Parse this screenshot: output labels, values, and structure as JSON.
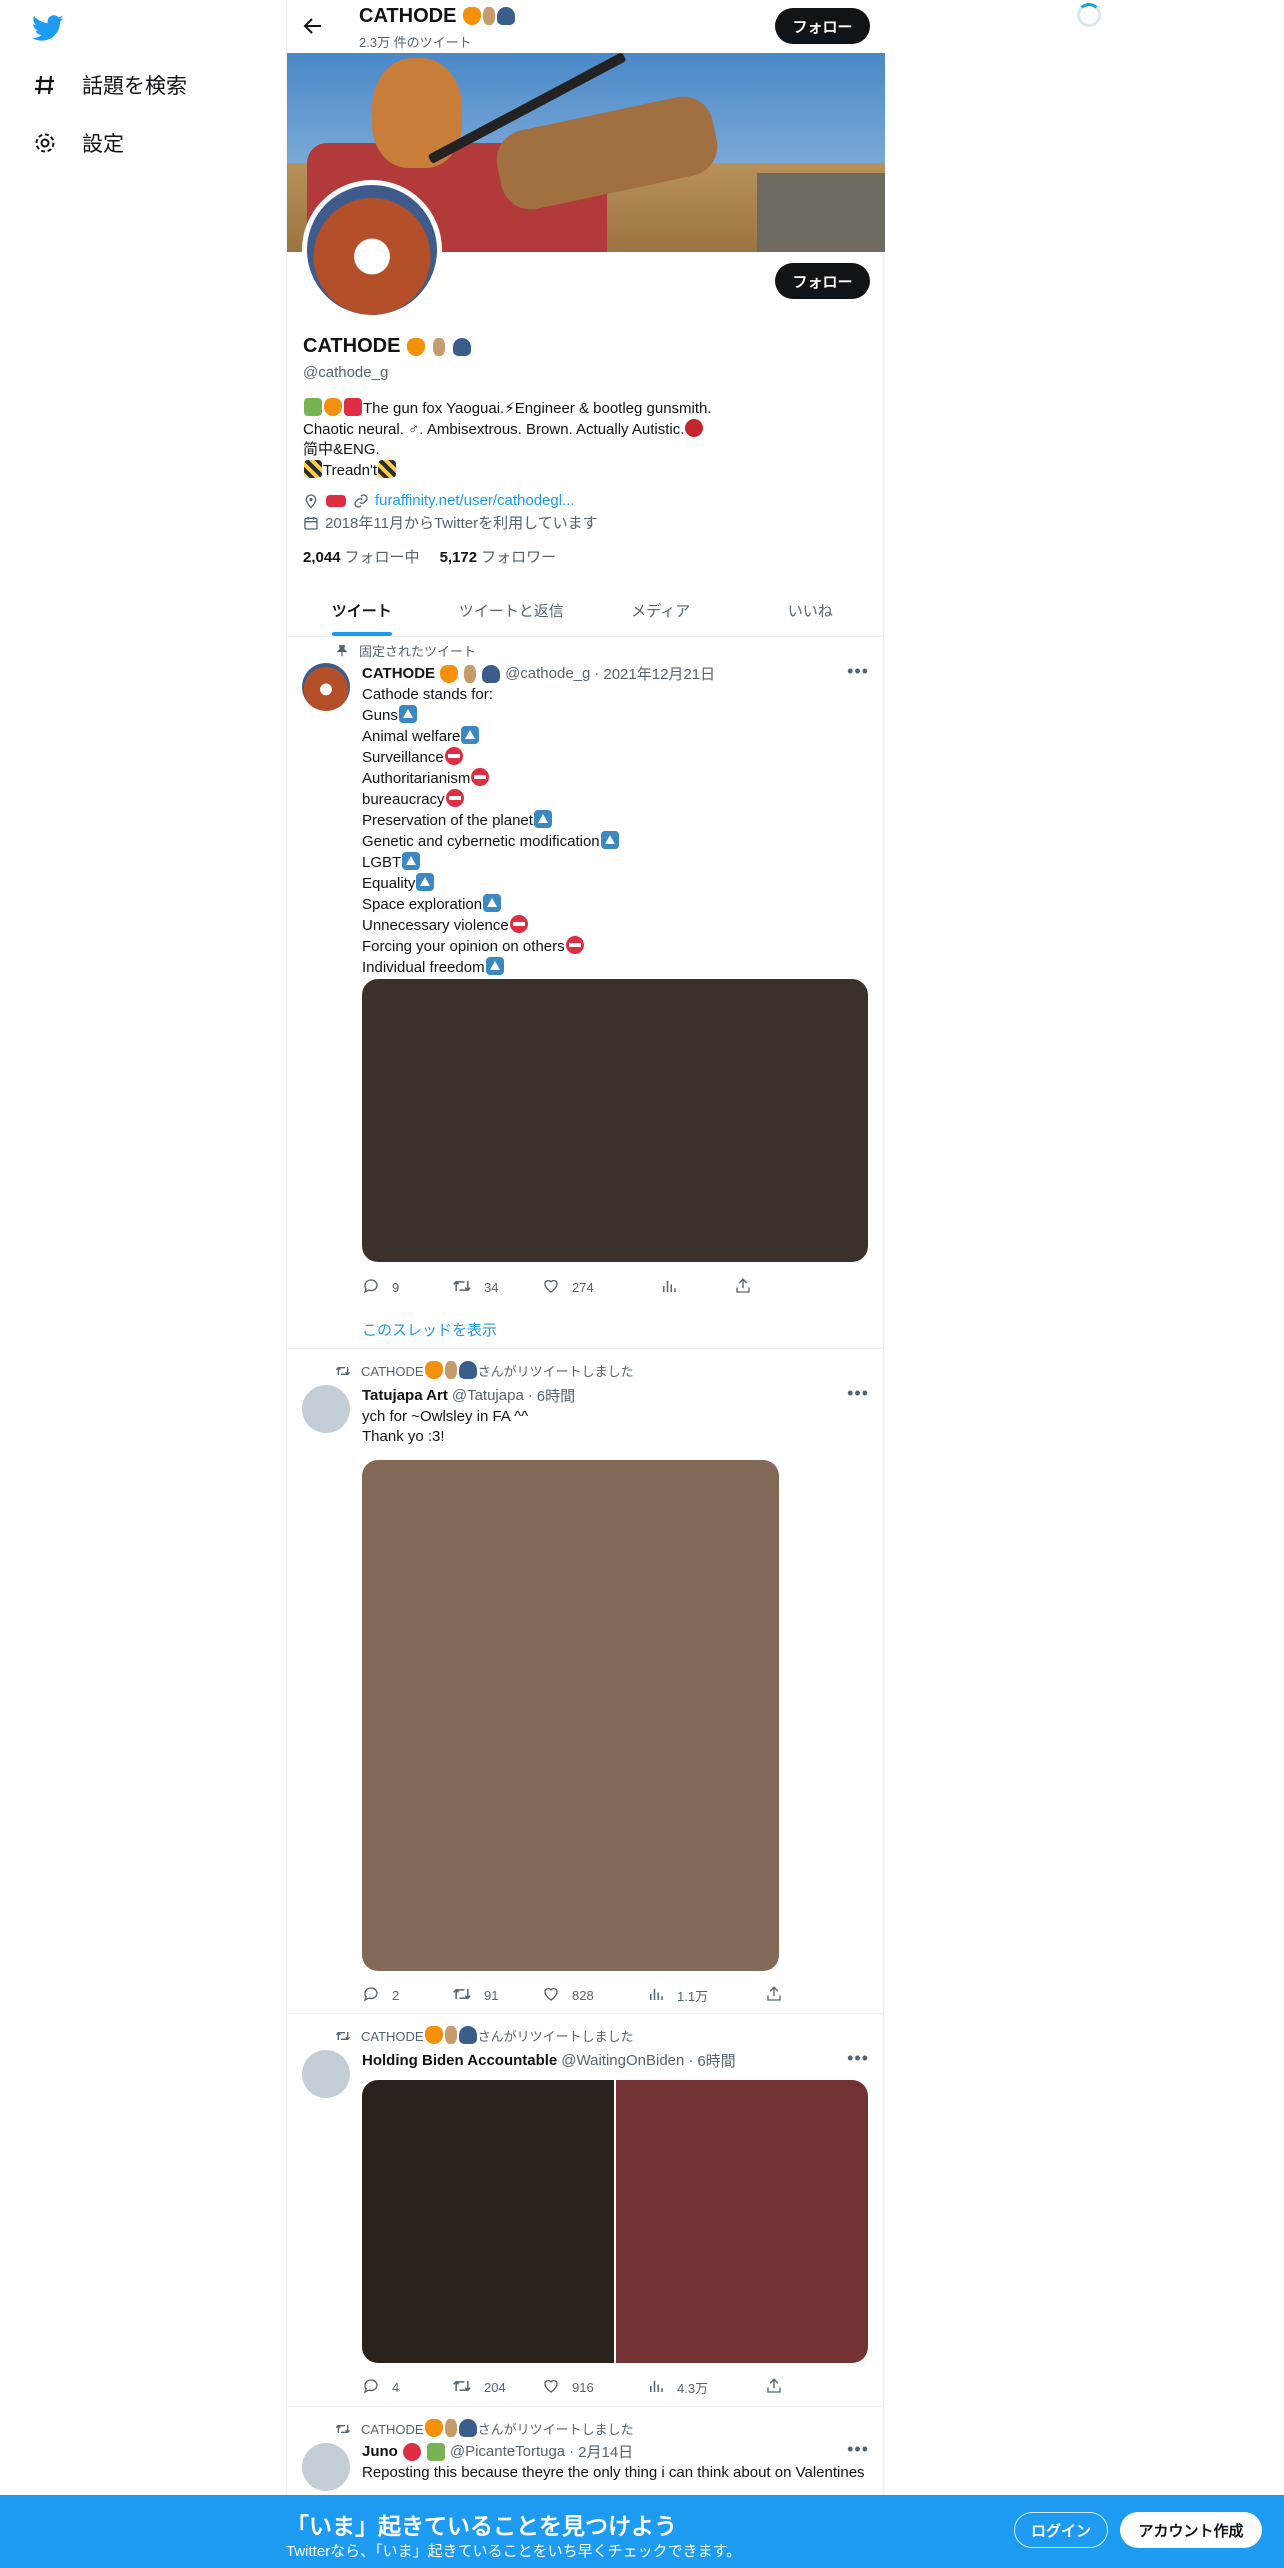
{
  "sidebar": {
    "items": [
      {
        "label": "話題を検索",
        "icon": "hashtag-icon"
      },
      {
        "label": "設定",
        "icon": "gear-icon"
      }
    ]
  },
  "topbar": {
    "name": "CATHODE",
    "tweet_count": "2.3万 件のツイート",
    "follow_label": "フォロー"
  },
  "profile": {
    "name": "CATHODE",
    "handle": "@cathode_g",
    "follow_label": "フォロー",
    "bio_lines": [
      "The gun fox Yaoguai.⚡Engineer & bootleg gunsmith.",
      "Chaotic neural. ♂. Ambisextrous. Brown. Actually Autistic.",
      "简中&ENG.",
      "Treadn't"
    ],
    "link": "furaffinity.net/user/cathodegl...",
    "joined": "2018年11月からTwitterを利用しています",
    "following_count": "2,044",
    "following_label": "フォロー中",
    "followers_count": "5,172",
    "followers_label": "フォロワー"
  },
  "tabs": [
    "ツイート",
    "ツイートと返信",
    "メディア",
    "いいね"
  ],
  "tweets": [
    {
      "context": "固定されたツイート",
      "name": "CATHODE",
      "handle": "@cathode_g",
      "time": "2021年12月21日",
      "lines": [
        {
          "text": "Cathode stands for:",
          "mark": ""
        },
        {
          "text": "Guns",
          "mark": "up"
        },
        {
          "text": "Animal welfare",
          "mark": "up"
        },
        {
          "text": "Surveillance",
          "mark": "no"
        },
        {
          "text": "Authoritarianism",
          "mark": "no"
        },
        {
          "text": "bureaucracy",
          "mark": "no"
        },
        {
          "text": "Preservation of the planet",
          "mark": "up"
        },
        {
          "text": "Genetic and cybernetic modification",
          "mark": "up"
        },
        {
          "text": "LGBT",
          "mark": "up"
        },
        {
          "text": "Equality",
          "mark": "up"
        },
        {
          "text": "Space exploration",
          "mark": "up"
        },
        {
          "text": "Unnecessary violence",
          "mark": "no"
        },
        {
          "text": "Forcing your opinion on others",
          "mark": "no"
        },
        {
          "text": "Individual freedom",
          "mark": "up"
        }
      ],
      "replies": "9",
      "retweets": "34",
      "likes": "274",
      "views": "",
      "show_thread": "このスレッドを表示",
      "media_colors": [
        "#3a312b"
      ]
    },
    {
      "context": "さんがリツイートしました",
      "context_name": "CATHODE",
      "name": "Tatujapa Art",
      "handle": "@Tatujapa",
      "time": "6時間",
      "lines": [
        {
          "text": "ych for ~Owlsley in FA ^^",
          "mark": ""
        },
        {
          "text": "Thank yo :3!",
          "mark": ""
        }
      ],
      "replies": "2",
      "retweets": "91",
      "likes": "828",
      "views": "1.1万",
      "media_colors": [
        "#836958"
      ]
    },
    {
      "context": "さんがリツイートしました",
      "context_name": "CATHODE",
      "name": "Holding Biden Accountable",
      "handle": "@WaitingOnBiden",
      "time": "6時間",
      "lines": [],
      "replies": "4",
      "retweets": "204",
      "likes": "916",
      "views": "4.3万",
      "media_colors": [
        "#2a221c",
        "#733234"
      ]
    },
    {
      "context": "さんがリツイートしました",
      "context_name": "CATHODE",
      "name": "Juno",
      "handle": "@PicanteTortuga",
      "time": "2月14日",
      "lines": [
        {
          "text": "Reposting this because theyre the only thing i can think about on Valentines",
          "mark": ""
        }
      ]
    }
  ],
  "bottom_bar": {
    "title": "「いま」起きていることを見つけよう",
    "subtitle": "Twitterなら、「いま」起きていることをいち早くチェックできます。",
    "login_label": "ログイン",
    "signup_label": "アカウント作成"
  },
  "colors": {
    "accent": "#1d9bf0",
    "dark_button": "#0f1419",
    "secondary_text": "#536471"
  }
}
